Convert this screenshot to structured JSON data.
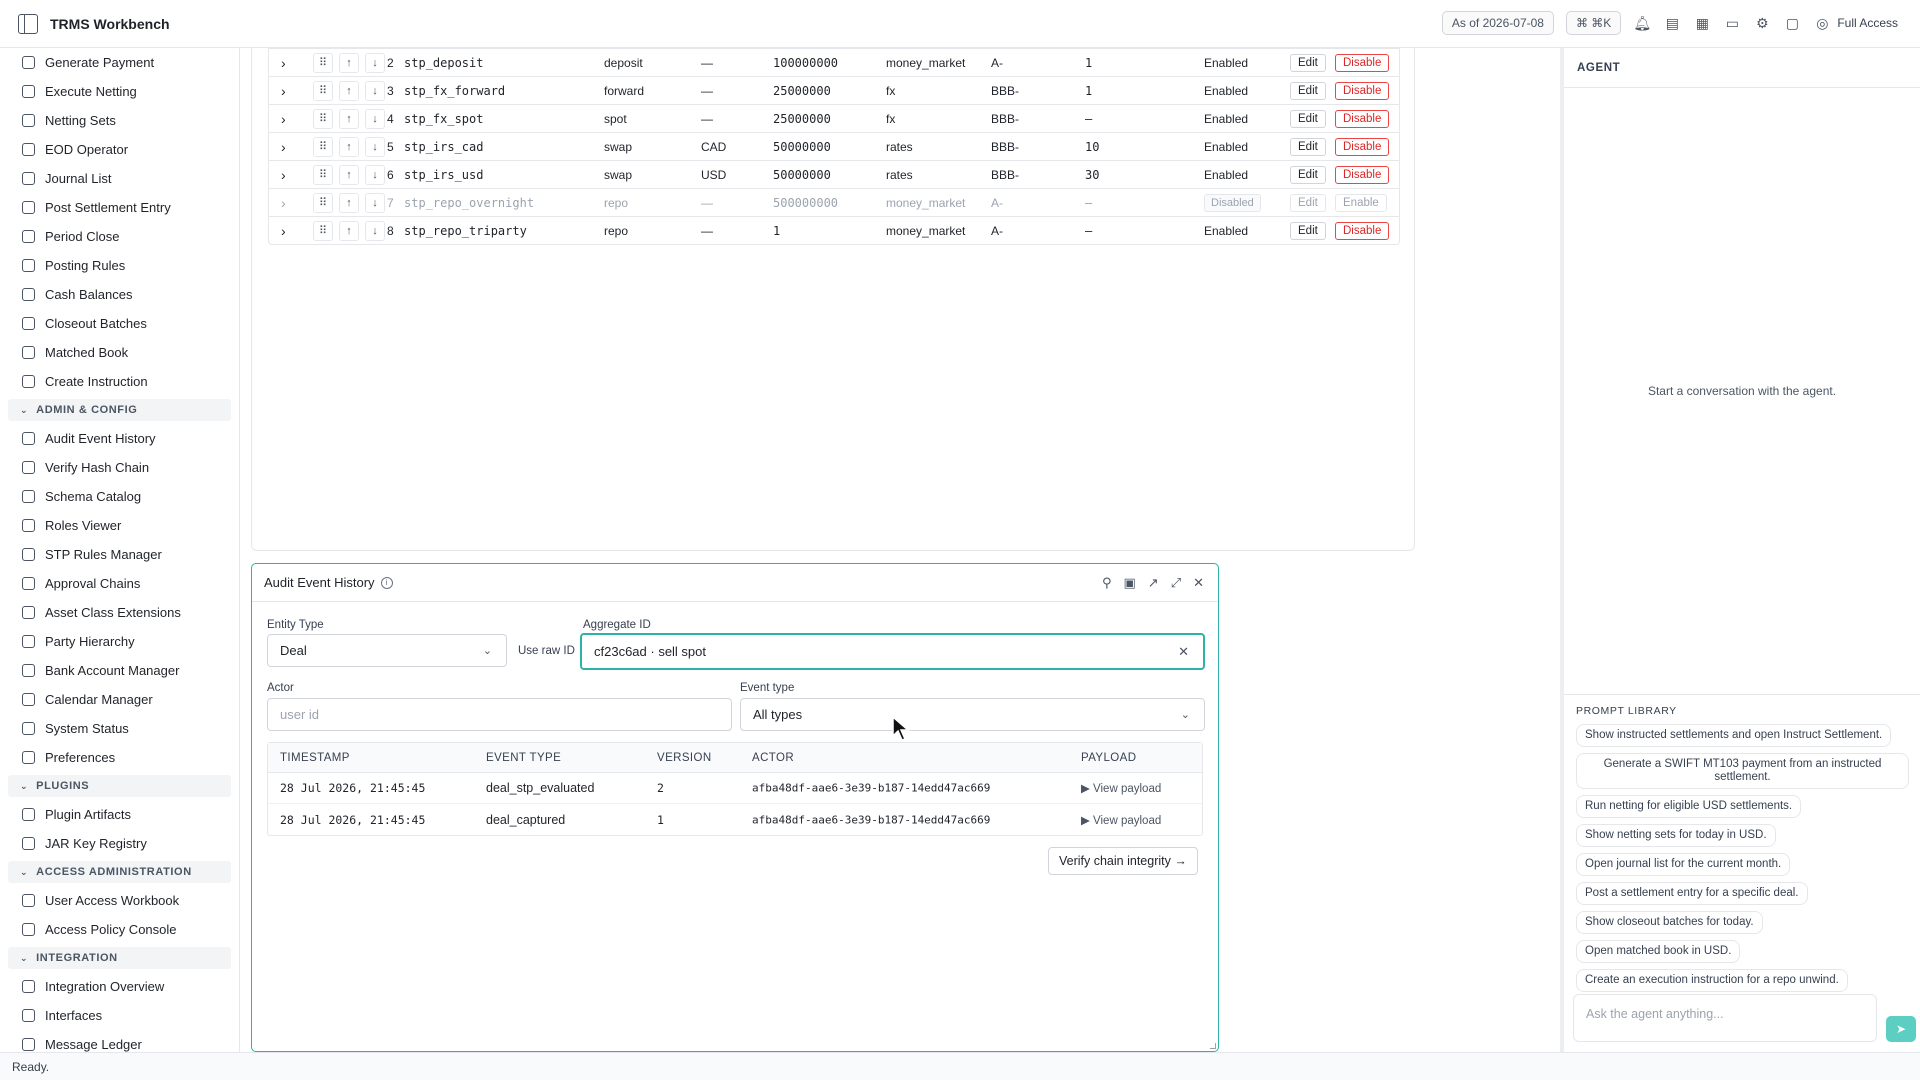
{
  "app": {
    "title": "TRMS Workbench",
    "as_of": "As of 2026-07-08",
    "shortcut": "⌘ ⌘K",
    "access": "Full Access"
  },
  "sidebar": {
    "items_top": [
      {
        "label": "Generate Payment"
      },
      {
        "label": "Execute Netting"
      },
      {
        "label": "Netting Sets"
      },
      {
        "label": "EOD Operator"
      },
      {
        "label": "Journal List"
      },
      {
        "label": "Post Settlement Entry"
      },
      {
        "label": "Period Close"
      },
      {
        "label": "Posting Rules"
      },
      {
        "label": "Cash Balances"
      },
      {
        "label": "Closeout Batches"
      },
      {
        "label": "Matched Book"
      },
      {
        "label": "Create Instruction"
      }
    ],
    "section_admin": "ADMIN & CONFIG",
    "items_admin": [
      {
        "label": "Audit Event History"
      },
      {
        "label": "Verify Hash Chain"
      },
      {
        "label": "Schema Catalog"
      },
      {
        "label": "Roles Viewer"
      },
      {
        "label": "STP Rules Manager"
      },
      {
        "label": "Approval Chains"
      },
      {
        "label": "Asset Class Extensions"
      },
      {
        "label": "Party Hierarchy"
      },
      {
        "label": "Bank Account Manager"
      },
      {
        "label": "Calendar Manager"
      },
      {
        "label": "System Status"
      },
      {
        "label": "Preferences"
      }
    ],
    "section_plugins": "PLUGINS",
    "items_plugins": [
      {
        "label": "Plugin Artifacts"
      },
      {
        "label": "JAR Key Registry"
      }
    ],
    "section_access": "ACCESS ADMINISTRATION",
    "items_access": [
      {
        "label": "User Access Workbook"
      },
      {
        "label": "Access Policy Console"
      }
    ],
    "section_integration": "INTEGRATION",
    "items_integration": [
      {
        "label": "Integration Overview"
      },
      {
        "label": "Interfaces"
      },
      {
        "label": "Message Ledger"
      }
    ]
  },
  "stp_rules": {
    "rows": [
      {
        "num": "2",
        "name": "stp_deposit",
        "product": "deposit",
        "ccy": "—",
        "limit": "100000000",
        "asset": "money_market",
        "rating": "A-",
        "days": "1",
        "status": "Enabled",
        "edit": "Edit",
        "toggle": "Disable",
        "disabled": false
      },
      {
        "num": "3",
        "name": "stp_fx_forward",
        "product": "forward",
        "ccy": "—",
        "limit": "25000000",
        "asset": "fx",
        "rating": "BBB-",
        "days": "1",
        "status": "Enabled",
        "edit": "Edit",
        "toggle": "Disable",
        "disabled": false
      },
      {
        "num": "4",
        "name": "stp_fx_spot",
        "product": "spot",
        "ccy": "—",
        "limit": "25000000",
        "asset": "fx",
        "rating": "BBB-",
        "days": "—",
        "status": "Enabled",
        "edit": "Edit",
        "toggle": "Disable",
        "disabled": false
      },
      {
        "num": "5",
        "name": "stp_irs_cad",
        "product": "swap",
        "ccy": "CAD",
        "limit": "50000000",
        "asset": "rates",
        "rating": "BBB-",
        "days": "10",
        "status": "Enabled",
        "edit": "Edit",
        "toggle": "Disable",
        "disabled": false
      },
      {
        "num": "6",
        "name": "stp_irs_usd",
        "product": "swap",
        "ccy": "USD",
        "limit": "50000000",
        "asset": "rates",
        "rating": "BBB-",
        "days": "30",
        "status": "Enabled",
        "edit": "Edit",
        "toggle": "Disable",
        "disabled": false
      },
      {
        "num": "7",
        "name": "stp_repo_overnight",
        "product": "repo",
        "ccy": "—",
        "limit": "500000000",
        "asset": "money_market",
        "rating": "A-",
        "days": "—",
        "status": "Disabled",
        "edit": "Edit",
        "toggle": "Enable",
        "disabled": true
      },
      {
        "num": "8",
        "name": "stp_repo_triparty",
        "product": "repo",
        "ccy": "—",
        "limit": "1",
        "asset": "money_market",
        "rating": "A-",
        "days": "—",
        "status": "Enabled",
        "edit": "Edit",
        "toggle": "Disable",
        "disabled": false
      }
    ]
  },
  "audit": {
    "title": "Audit Event History",
    "entity_type_label": "Entity Type",
    "entity_type_value": "Deal",
    "use_raw_id": "Use raw ID",
    "aggregate_label": "Aggregate ID",
    "aggregate_value": "cf23c6ad · sell spot",
    "actor_label": "Actor",
    "actor_placeholder": "user id",
    "event_type_label": "Event type",
    "event_type_value": "All types",
    "columns": [
      "TIMESTAMP",
      "EVENT TYPE",
      "VERSION",
      "ACTOR",
      "PAYLOAD"
    ],
    "rows": [
      {
        "timestamp": "28 Jul 2026, 21:45:45",
        "event_type": "deal_stp_evaluated",
        "version": "2",
        "actor": "afba48df-aae6-3e39-b187-14edd47ac669",
        "payload": "▶ View payload"
      },
      {
        "timestamp": "28 Jul 2026, 21:45:45",
        "event_type": "deal_captured",
        "version": "1",
        "actor": "afba48df-aae6-3e39-b187-14edd47ac669",
        "payload": "▶ View payload"
      }
    ],
    "verify_button": "Verify chain integrity →"
  },
  "agent": {
    "header": "AGENT",
    "empty": "Start a conversation with the agent.",
    "library_title": "PROMPT LIBRARY",
    "prompts": [
      "Show instructed settlements and open Instruct Settlement.",
      "Generate a SWIFT MT103 payment from an instructed settlement.",
      "Run netting for eligible USD settlements.",
      "Show netting sets for today in USD.",
      "Open journal list for the current month.",
      "Post a settlement entry for a specific deal.",
      "Show closeout batches for today.",
      "Open matched book in USD.",
      "Create an execution instruction for a repo unwind."
    ],
    "input_placeholder": "Ask the agent anything..."
  },
  "status": "Ready.",
  "colors": {
    "accent": "#2ab3a6",
    "danger": "#dc2626"
  }
}
